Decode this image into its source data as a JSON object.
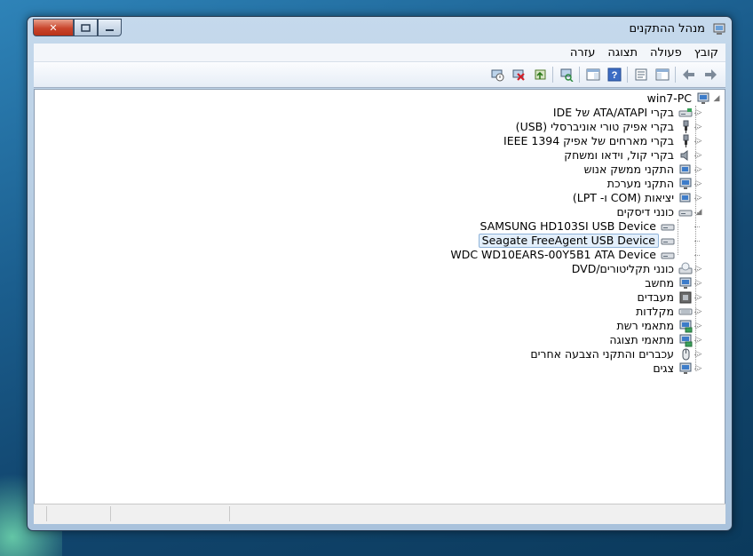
{
  "window": {
    "title": "מנהל ההתקנים"
  },
  "caption": {
    "close": "✕",
    "maximize": "▫",
    "minimize": "–"
  },
  "menu": [
    "קובץ",
    "פעולה",
    "תצוגה",
    "עזרה"
  ],
  "tree": {
    "root": "win7-PC",
    "categories": [
      {
        "label": "בקרי ATA/ATAPI של IDE",
        "icon": "ide-controller-icon"
      },
      {
        "label": "בקרי אפיק טורי אוניברסלי (USB)",
        "icon": "usb-icon"
      },
      {
        "label": "בקרי מארחים של אפיק IEEE 1394",
        "icon": "firewire-icon"
      },
      {
        "label": "בקרי קול, וידאו ומשחק",
        "icon": "speaker-icon"
      },
      {
        "label": "התקני ממשק אנוש",
        "icon": "hid-icon"
      },
      {
        "label": "התקני מערכת",
        "icon": "system-device-icon"
      },
      {
        "label": "יציאות (COM ו- LPT)",
        "icon": "port-icon"
      },
      {
        "label": "כונני דיסקים",
        "icon": "disk-drive-icon",
        "expanded": true,
        "children": [
          {
            "label": "SAMSUNG HD103SI USB Device",
            "icon": "disk-icon"
          },
          {
            "label": "Seagate FreeAgent USB Device",
            "icon": "disk-icon",
            "selected": true
          },
          {
            "label": "WDC WD10EARS-00Y5B1 ATA Device",
            "icon": "disk-icon"
          }
        ]
      },
      {
        "label": "כונני תקליטורים/DVD",
        "icon": "dvd-drive-icon"
      },
      {
        "label": "מחשב",
        "icon": "computer-icon"
      },
      {
        "label": "מעבדים",
        "icon": "processor-icon"
      },
      {
        "label": "מקלדות",
        "icon": "keyboard-icon"
      },
      {
        "label": "מתאמי רשת",
        "icon": "network-adapter-icon"
      },
      {
        "label": "מתאמי תצוגה",
        "icon": "display-adapter-icon"
      },
      {
        "label": "עכברים והתקני הצבעה אחרים",
        "icon": "mouse-icon"
      },
      {
        "label": "צגים",
        "icon": "monitor-icon"
      }
    ]
  },
  "colors": {
    "selection_bg": "#e3effb",
    "selection_border": "#8fb3d9",
    "titlebar": "#b7cde3"
  }
}
